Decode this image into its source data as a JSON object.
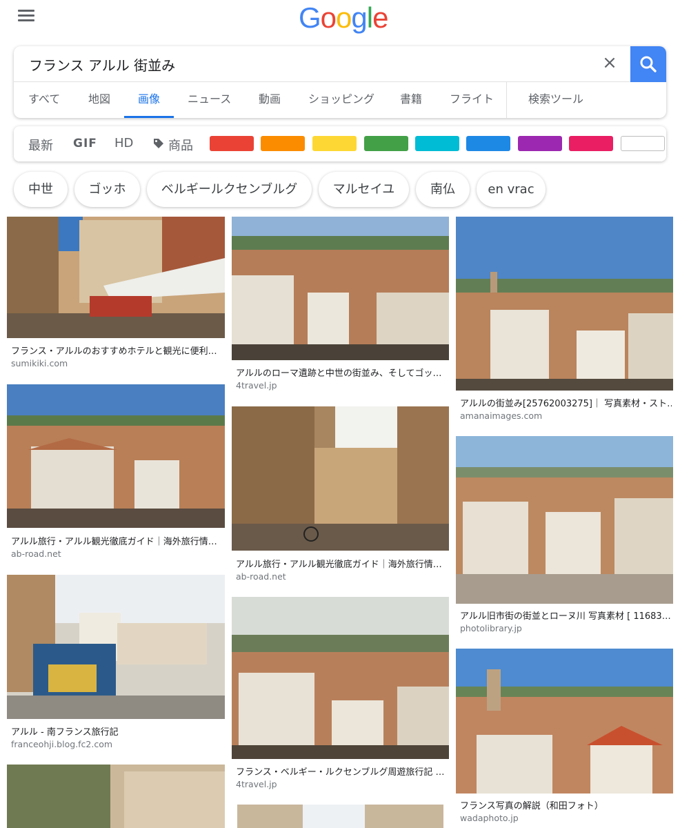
{
  "header": {
    "logo_letters": [
      {
        "ch": "G",
        "color": "#4285F4"
      },
      {
        "ch": "o",
        "color": "#EA4335"
      },
      {
        "ch": "o",
        "color": "#FBBC05"
      },
      {
        "ch": "g",
        "color": "#4285F4"
      },
      {
        "ch": "l",
        "color": "#34A853"
      },
      {
        "ch": "e",
        "color": "#EA4335"
      }
    ],
    "menu_icon": "hamburger-menu-icon"
  },
  "search": {
    "query": "フランス アルル 街並み",
    "clear_icon": "close-icon",
    "button_icon": "search-icon",
    "button_color": "#4285f4"
  },
  "tabs": [
    {
      "label": "すべて"
    },
    {
      "label": "地図"
    },
    {
      "label": "画像"
    },
    {
      "label": "ニュース"
    },
    {
      "label": "動画"
    },
    {
      "label": "ショッピング"
    },
    {
      "label": "書籍"
    },
    {
      "label": "フライト"
    },
    {
      "label": "検索ツール"
    }
  ],
  "filters": {
    "latest": "最新",
    "gif": "GIF",
    "hd": "HD",
    "products": "商品",
    "tag_icon": "tag-icon",
    "colors": [
      "#ea4335",
      "#fb8c00",
      "#fdd835",
      "#43a047",
      "#00bcd4",
      "#1e88e5",
      "#9c27b0",
      "#e91e63",
      "#ffffff"
    ]
  },
  "chips": [
    {
      "label": "中世"
    },
    {
      "label": "ゴッホ"
    },
    {
      "label": "ベルギールクセンブルグ"
    },
    {
      "label": "マルセイユ"
    },
    {
      "label": "南仏"
    },
    {
      "label": "en vrac"
    }
  ],
  "results": [
    {
      "title": "フランス・アルルのおすすめホテルと観光に便利…",
      "source": "sumikiki.com"
    },
    {
      "title": "アルル旅行・アルル観光徹底ガイド｜海外旅行情…",
      "source": "ab-road.net"
    },
    {
      "title": "アルル - 南フランス旅行記",
      "source": "franceohji.blog.fc2.com"
    },
    {
      "title": "アルルのローマ遺跡と中世の街並み、そしてゴッ…",
      "source": "4travel.jp"
    },
    {
      "title": "アルル旅行・アルル観光徹底ガイド｜海外旅行情…",
      "source": "ab-road.net"
    },
    {
      "title": "フランス・ベルギー・ルクセンブルグ周遊旅行記 …",
      "source": "4travel.jp"
    },
    {
      "title": "アルルの街並み[25762003275]｜ 写真素材・スト…",
      "source": "amanaimages.com"
    },
    {
      "title": "アルル旧市街の街並とローヌ川 写真素材 [ 11683…",
      "source": "photolibrary.jp"
    },
    {
      "title": "フランス写真の解説（和田フォト）",
      "source": "wadaphoto.jp"
    }
  ]
}
